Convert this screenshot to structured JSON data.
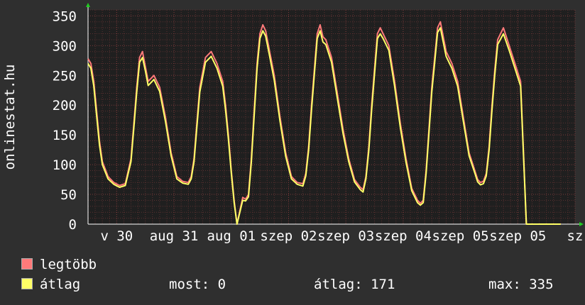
{
  "colors": {
    "background": "#2f2f2f",
    "plot_background": "#1f1f1f",
    "max_line": "#ff7a7a",
    "avg_line": "#ffff66",
    "grid": "#5a3030"
  },
  "legend": {
    "max_label": "legtöbb",
    "avg_label": "átlag",
    "now": "most: 0",
    "avg": "átlag: 171",
    "max": "max: 335"
  },
  "chart_data": {
    "type": "line",
    "ylabel": "onlinestat.hu",
    "ylim": [
      0,
      360
    ],
    "yticks": [
      0,
      50,
      100,
      150,
      200,
      250,
      300,
      350
    ],
    "xlim": [
      0,
      8.5
    ],
    "xticks": [
      {
        "pos": 0.5,
        "label": "v 30"
      },
      {
        "pos": 1.5,
        "label": "aug 31"
      },
      {
        "pos": 2.5,
        "label": "aug 01"
      },
      {
        "pos": 3.5,
        "label": "szep 02"
      },
      {
        "pos": 4.5,
        "label": "szep 03"
      },
      {
        "pos": 5.5,
        "label": "szep 04"
      },
      {
        "pos": 6.5,
        "label": "szep 05"
      },
      {
        "pos": 7.5,
        "label": "szep 05"
      },
      {
        "pos": 8.5,
        "label": "sz"
      }
    ],
    "grid": true,
    "series": [
      {
        "name": "legtöbb",
        "x": [
          0,
          0.05,
          0.1,
          0.15,
          0.2,
          0.25,
          0.35,
          0.45,
          0.55,
          0.65,
          0.75,
          0.8,
          0.85,
          0.9,
          0.95,
          1.0,
          1.05,
          1.1,
          1.15,
          1.25,
          1.35,
          1.45,
          1.55,
          1.65,
          1.75,
          1.8,
          1.85,
          1.9,
          1.95,
          2.05,
          2.15,
          2.25,
          2.35,
          2.4,
          2.45,
          2.5,
          2.55,
          2.6,
          2.7,
          2.75,
          2.8,
          2.85,
          2.9,
          2.95,
          3.0,
          3.05,
          3.1,
          3.15,
          3.25,
          3.35,
          3.45,
          3.55,
          3.65,
          3.75,
          3.8,
          3.85,
          3.9,
          3.95,
          4.0,
          4.05,
          4.1,
          4.15,
          4.25,
          4.35,
          4.45,
          4.55,
          4.65,
          4.75,
          4.8,
          4.85,
          4.9,
          4.95,
          5.0,
          5.05,
          5.1,
          5.15,
          5.25,
          5.35,
          5.45,
          5.55,
          5.65,
          5.75,
          5.8,
          5.85,
          5.9,
          5.95,
          6.0,
          6.05,
          6.1,
          6.15,
          6.25,
          6.35,
          6.45,
          6.55,
          6.65,
          6.75,
          6.8,
          6.85,
          6.9,
          6.95,
          7.0,
          7.05,
          7.1,
          7.15,
          7.25,
          7.35,
          7.45,
          7.55,
          7.65,
          7.75,
          7.8,
          7.85,
          7.9,
          7.95,
          8.0,
          8.05,
          8.1,
          8.2,
          8.25
        ],
        "values": [
          278,
          270,
          240,
          190,
          140,
          105,
          80,
          70,
          65,
          68,
          110,
          170,
          230,
          280,
          290,
          265,
          240,
          245,
          250,
          230,
          180,
          120,
          80,
          72,
          70,
          80,
          110,
          170,
          230,
          280,
          290,
          270,
          240,
          200,
          150,
          90,
          40,
          0,
          45,
          42,
          50,
          110,
          190,
          270,
          320,
          335,
          325,
          300,
          250,
          180,
          120,
          80,
          70,
          68,
          85,
          130,
          200,
          260,
          320,
          335,
          315,
          310,
          280,
          220,
          160,
          110,
          75,
          62,
          58,
          80,
          130,
          200,
          260,
          320,
          330,
          320,
          300,
          240,
          170,
          110,
          60,
          40,
          35,
          40,
          90,
          160,
          230,
          280,
          330,
          340,
          290,
          270,
          240,
          180,
          120,
          90,
          75,
          70,
          72,
          85,
          130,
          200,
          260,
          310,
          330,
          300,
          270,
          240,
          0,
          0,
          0,
          0,
          0,
          0,
          0,
          0,
          0,
          0,
          0
        ]
      },
      {
        "name": "átlag",
        "x": [
          0,
          0.05,
          0.1,
          0.15,
          0.2,
          0.25,
          0.35,
          0.45,
          0.55,
          0.65,
          0.75,
          0.8,
          0.85,
          0.9,
          0.95,
          1.0,
          1.05,
          1.1,
          1.15,
          1.25,
          1.35,
          1.45,
          1.55,
          1.65,
          1.75,
          1.8,
          1.85,
          1.9,
          1.95,
          2.05,
          2.15,
          2.25,
          2.35,
          2.4,
          2.45,
          2.5,
          2.55,
          2.6,
          2.7,
          2.75,
          2.8,
          2.85,
          2.9,
          2.95,
          3.0,
          3.05,
          3.1,
          3.15,
          3.25,
          3.35,
          3.45,
          3.55,
          3.65,
          3.75,
          3.8,
          3.85,
          3.9,
          3.95,
          4.0,
          4.05,
          4.1,
          4.15,
          4.25,
          4.35,
          4.45,
          4.55,
          4.65,
          4.75,
          4.8,
          4.85,
          4.9,
          4.95,
          5.0,
          5.05,
          5.1,
          5.15,
          5.25,
          5.35,
          5.45,
          5.55,
          5.65,
          5.75,
          5.8,
          5.85,
          5.9,
          5.95,
          6.0,
          6.05,
          6.1,
          6.15,
          6.25,
          6.35,
          6.45,
          6.55,
          6.65,
          6.75,
          6.8,
          6.85,
          6.9,
          6.95,
          7.0,
          7.05,
          7.1,
          7.15,
          7.25,
          7.35,
          7.45,
          7.55,
          7.65,
          7.75,
          7.8,
          7.85,
          7.9,
          7.95,
          8.0,
          8.05,
          8.1,
          8.2,
          8.25
        ],
        "values": [
          270,
          262,
          232,
          182,
          133,
          100,
          76,
          67,
          62,
          65,
          105,
          163,
          222,
          272,
          280,
          258,
          233,
          238,
          243,
          223,
          173,
          115,
          76,
          69,
          67,
          76,
          105,
          163,
          222,
          272,
          282,
          262,
          232,
          192,
          143,
          86,
          36,
          0,
          40,
          39,
          46,
          104,
          182,
          262,
          312,
          325,
          316,
          292,
          242,
          173,
          114,
          76,
          67,
          64,
          81,
          124,
          192,
          252,
          312,
          325,
          306,
          302,
          272,
          212,
          153,
          105,
          71,
          58,
          54,
          76,
          124,
          192,
          252,
          312,
          320,
          312,
          292,
          232,
          163,
          104,
          56,
          36,
          32,
          36,
          85,
          153,
          222,
          272,
          322,
          330,
          282,
          262,
          232,
          173,
          115,
          86,
          71,
          66,
          68,
          81,
          124,
          192,
          252,
          302,
          320,
          292,
          262,
          232,
          0,
          0,
          0,
          0,
          0,
          0,
          0,
          0,
          0,
          0,
          0
        ]
      }
    ]
  }
}
